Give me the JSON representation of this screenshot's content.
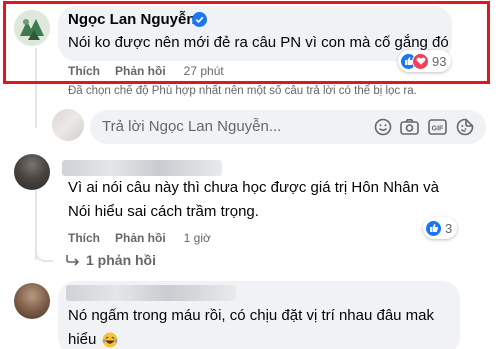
{
  "comment1": {
    "author": "Ngọc Lan Nguyễn",
    "text": "Nói ko được nên mới đẻ ra câu PN vì con mà cố gắng đó",
    "like_label": "Thích",
    "reply_label": "Phản hồi",
    "time": "27 phút",
    "reaction_count": "93",
    "highlight_color": "#e4151d"
  },
  "filter_notice": "Đã chọn chế độ Phù hợp nhất nên một số câu trả lời có thể bị lọc ra.",
  "reply_box": {
    "placeholder": "Trả lời Ngọc Lan Nguyễn..."
  },
  "comment2": {
    "text_line1": "Vì ai nói câu này thì chưa học được giá trị Hôn Nhân và",
    "text_line2": "Nói hiểu sai cách trầm trọng.",
    "like_label": "Thích",
    "reply_label": "Phản hồi",
    "time": "1 giờ",
    "reaction_count": "3",
    "replies_label": "1 phản hồi"
  },
  "comment3": {
    "text_line1": "Nó ngấm trong máu rồi, có chịu đặt vị trí nhau đâu mak",
    "text_line2": "hiểu"
  },
  "icons": [
    "verified-badge-icon",
    "like-icon",
    "love-icon",
    "emoji-icon",
    "camera-icon",
    "gif-icon",
    "sticker-icon",
    "reply-arrow-icon",
    "laughing-emoji-icon"
  ],
  "colors": {
    "accent": "#1877f2",
    "highlight_border": "#e4151d",
    "bubble": "#f0f2f5",
    "muted_text": "#65676b"
  }
}
